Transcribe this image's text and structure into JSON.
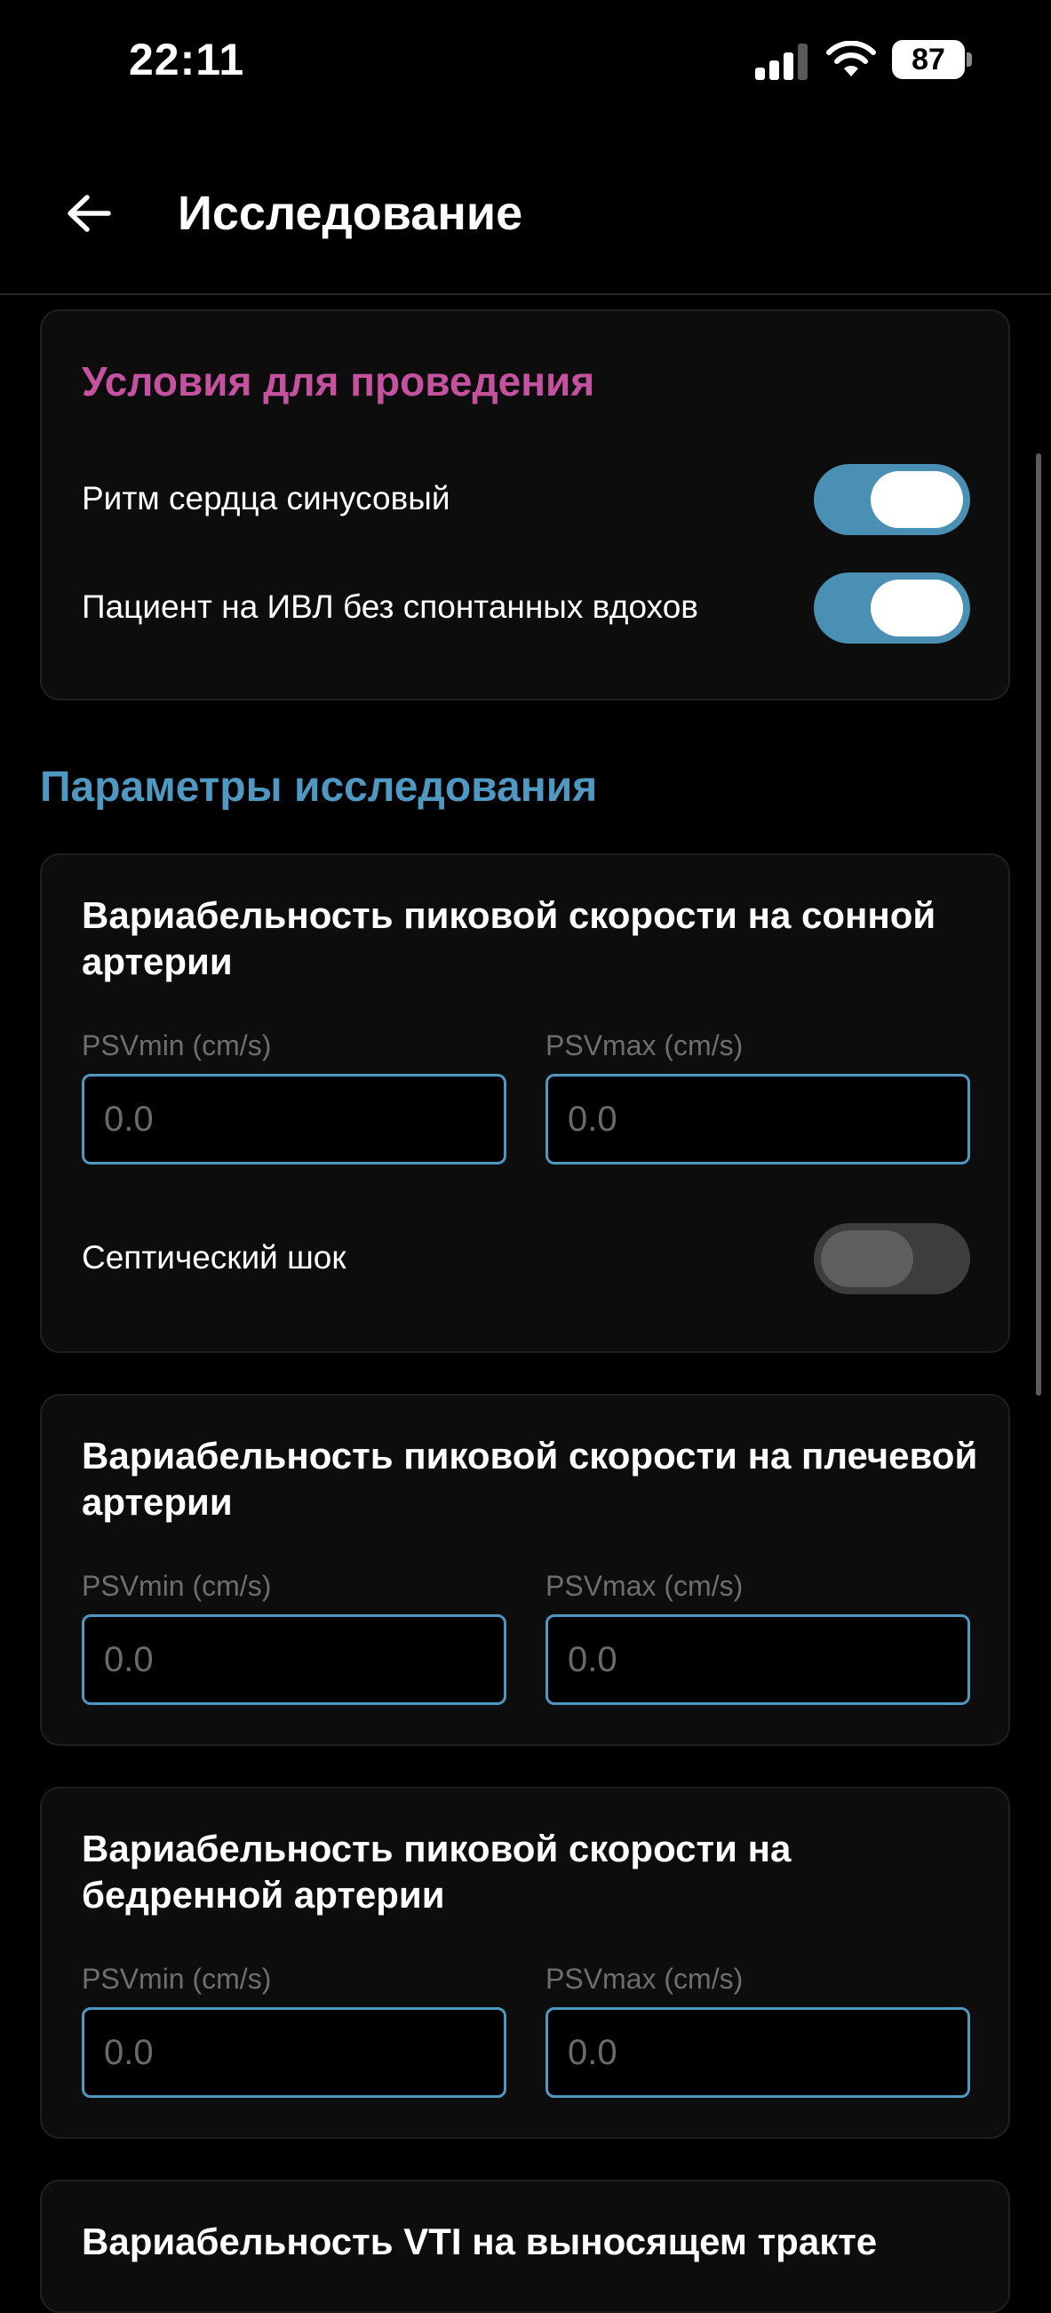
{
  "status_bar": {
    "time": "22:11",
    "battery": "87"
  },
  "header": {
    "title": "Исследование"
  },
  "conditions": {
    "title": "Условия для проведения",
    "items": [
      {
        "label": "Ритм сердца синусовый",
        "enabled": true
      },
      {
        "label": "Пациент на ИВЛ без спонтанных вдохов",
        "enabled": true
      }
    ]
  },
  "parameters": {
    "heading": "Параметры исследования",
    "cards": [
      {
        "title": "Вариабельность пиковой скорости на сонной артерии",
        "min_label": "PSVmin (cm/s)",
        "max_label": "PSVmax (cm/s)",
        "min_placeholder": "0.0",
        "max_placeholder": "0.0",
        "toggle_label": "Септический шок",
        "toggle_enabled": false
      },
      {
        "title": "Вариабельность пиковой скорости на плечевой артерии",
        "min_label": "PSVmin (cm/s)",
        "max_label": "PSVmax (cm/s)",
        "min_placeholder": "0.0",
        "max_placeholder": "0.0"
      },
      {
        "title": "Вариабельность пиковой скорости на бедренной артерии",
        "min_label": "PSVmin (cm/s)",
        "max_label": "PSVmax (cm/s)",
        "min_placeholder": "0.0",
        "max_placeholder": "0.0"
      },
      {
        "title": "Вариабельность VTI на выносящем тракте"
      }
    ]
  },
  "colors": {
    "accent_pink": "#c4529f",
    "accent_blue": "#4f98c2",
    "toggle_on": "#4a90b5",
    "background": "#000000",
    "card": "#0d0d0d"
  }
}
